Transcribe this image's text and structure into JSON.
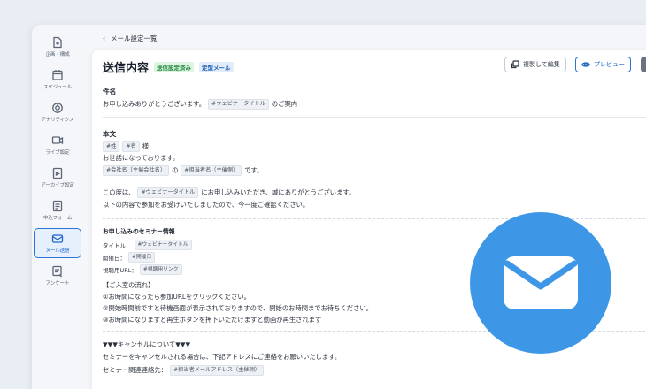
{
  "sidebar": {
    "items": [
      {
        "label": "企画・構成",
        "icon": "file-plus-icon"
      },
      {
        "label": "スケジュール",
        "icon": "calendar-icon"
      },
      {
        "label": "アナリティクス",
        "icon": "analytics-icon"
      },
      {
        "label": "ライブ設定",
        "icon": "live-camera-icon"
      },
      {
        "label": "アーカイブ設定",
        "icon": "archive-icon"
      },
      {
        "label": "申込フォーム",
        "icon": "form-icon"
      },
      {
        "label": "メール送信",
        "icon": "mail-icon",
        "active": true
      },
      {
        "label": "アンケート",
        "icon": "survey-icon"
      }
    ]
  },
  "breadcrumb": {
    "back_label": "メール設定一覧"
  },
  "header": {
    "title": "送信内容",
    "badge_status": "送信設定済み",
    "badge_type": "定型メール",
    "copy_edit_label": "複製して編集",
    "preview_label": "プレビュー"
  },
  "subject": {
    "label": "件名",
    "prefix": "お申し込みありがとうございます。",
    "tag": "#ウェビナータイトル",
    "suffix": "のご案内"
  },
  "body": {
    "label": "本文",
    "l1_tag1": "#姓",
    "l1_tag2": "#名",
    "l1_text": "様",
    "l2_text": "お世話になっております。",
    "l3_tag1": "#会社名（主催会社名）",
    "l3_mid": "の",
    "l3_tag2": "#担当者名（主催側）",
    "l3_end": "です。",
    "l4_prefix": "この度は、",
    "l4_tag": "#ウェビナータイトル",
    "l4_suffix": "にお申し込みいただき、誠にありがとうございます。",
    "l5_text": "以下の内容で参加をお受けいたしましたので、今一度ご確認ください。"
  },
  "seminar": {
    "heading": "お申し込みのセミナー情報",
    "title_label": "タイトル：",
    "title_tag": "#ウェビナータイトル",
    "date_label": "開催日：",
    "date_tag": "#開催日",
    "url_label": "視聴用URL：",
    "url_tag": "#視聴用リンク"
  },
  "flow": {
    "heading": "【ご入室の流れ】",
    "step1": "①お時間になったら参加URLをクリックください。",
    "step2": "②開始時間前ですと待機画面が表示されておりますので、開始のお時間までお待ちください。",
    "step3": "③お時間になりますと再生ボタンを押下いただけますと動画が再生されます"
  },
  "cancel": {
    "heading": "▼▼▼キャンセルについて▼▼▼",
    "text": "セミナーをキャンセルされる場合は、下記アドレスにご連絡をお願いいたします。",
    "contact_label": "セミナー関連連絡先：",
    "contact_tag": "#担当者メールアドレス（主催側）"
  },
  "colors": {
    "accent": "#2b73d8",
    "mail_circle": "#3d97e6",
    "status_green": "#1f8a3c"
  }
}
